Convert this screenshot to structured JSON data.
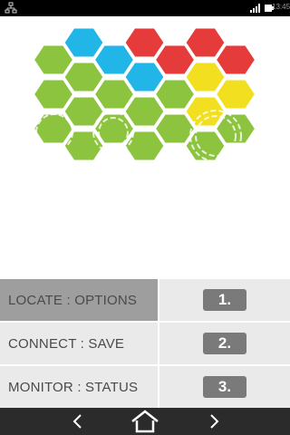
{
  "statusbar": {
    "time": "13:45",
    "icons": [
      "network-icon",
      "signal-icon",
      "battery-icon"
    ]
  },
  "colors": {
    "green": "#8cc43f",
    "blue": "#21b5e8",
    "red": "#e63b3b",
    "yellow": "#f2df1f",
    "menu_bg": "#eaeaea",
    "menu_active_bg": "#9e9e9e",
    "button_bg": "#7a7a7a",
    "navbar_bg": "#2b2b2b"
  },
  "menu": {
    "items": [
      {
        "label": "LOCATE : OPTIONS",
        "button": "1.",
        "active": true
      },
      {
        "label": "CONNECT : SAVE",
        "button": "2.",
        "active": false
      },
      {
        "label": "MONITOR : STATUS",
        "button": "3.",
        "active": false
      }
    ]
  },
  "navbar": {
    "icons": [
      "back-arrow-icon",
      "home-icon",
      "forward-arrow-icon"
    ]
  }
}
